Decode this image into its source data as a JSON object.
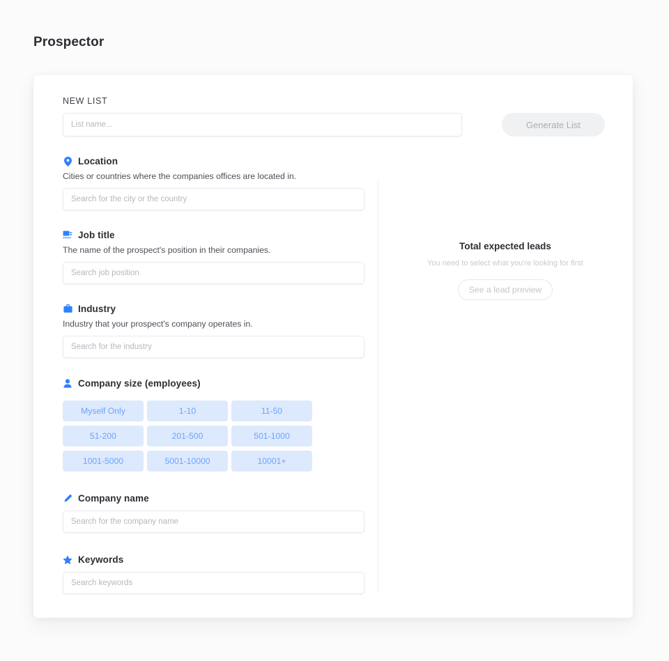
{
  "page": {
    "title": "Prospector",
    "background_color": "#fbfbfc"
  },
  "colors": {
    "accent_blue": "#2f80ff",
    "chip_bg": "#dde9fd",
    "chip_text": "#6ca4fb",
    "text_dark": "#2b2e33",
    "text_muted": "#b4b8bf"
  },
  "new_list": {
    "label": "NEW LIST",
    "name_input": {
      "value": "",
      "placeholder": "List name..."
    },
    "generate_button": "Generate List"
  },
  "filters": [
    {
      "key": "location",
      "icon": "map-pin-icon",
      "title": "Location",
      "description": "Cities or countries where the companies offices are located in.",
      "input": {
        "value": "",
        "placeholder": "Search for the city or the country"
      }
    },
    {
      "key": "job-title",
      "icon": "badge-icon",
      "title": "Job title",
      "description": "The name of the prospect's position in their companies.",
      "input": {
        "value": "",
        "placeholder": "Search job position"
      }
    },
    {
      "key": "industry",
      "icon": "briefcase-icon",
      "title": "Industry",
      "description": "Industry that your prospect's company operates in.",
      "input": {
        "value": "",
        "placeholder": "Search for the industry"
      }
    }
  ],
  "company_size": {
    "icon": "user-icon",
    "title": "Company size (employees)",
    "options": [
      "Myself Only",
      "1-10",
      "11-50",
      "51-200",
      "201-500",
      "501-1000",
      "1001-5000",
      "5001-10000",
      "10001+"
    ]
  },
  "company_name": {
    "icon": "pencil-icon",
    "title": "Company name",
    "input": {
      "value": "",
      "placeholder": "Search for the company name"
    }
  },
  "keywords": {
    "icon": "star-icon",
    "title": "Keywords",
    "input": {
      "value": "",
      "placeholder": "Search keywords"
    }
  },
  "summary": {
    "title": "Total expected leads",
    "subtitle": "You need to select what you're looking for first",
    "preview_button": "See a lead preview"
  }
}
